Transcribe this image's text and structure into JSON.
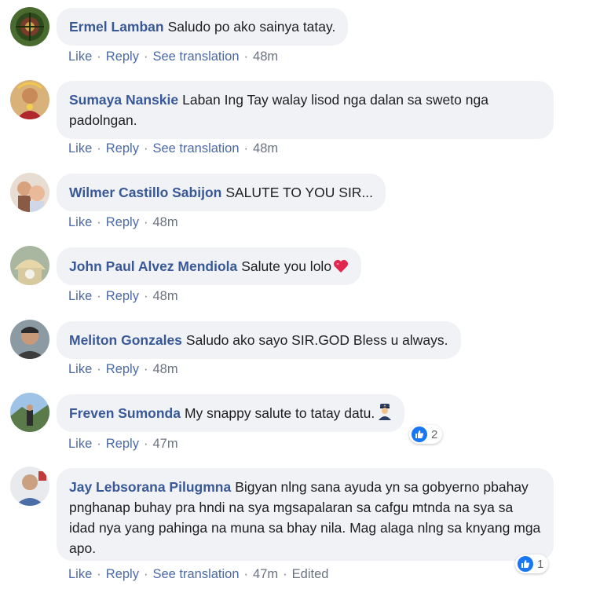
{
  "comments": [
    {
      "author": "Ermel Lamban",
      "text": "Saludo po ako sainya tatay.",
      "actions": [
        "Like",
        "Reply",
        "See translation"
      ],
      "time": "48m"
    },
    {
      "author": "Sumaya Nanskie",
      "text": "Laban Ing Tay walay lisod nga dalan sa sweto nga padolngan.",
      "actions": [
        "Like",
        "Reply",
        "See translation"
      ],
      "time": "48m"
    },
    {
      "author": "Wilmer Castillo Sabijon",
      "text": "SALUTE TO YOU SIR...",
      "actions": [
        "Like",
        "Reply"
      ],
      "time": "48m"
    },
    {
      "author": "John Paul Alvez Mendiola",
      "text": "Salute you lolo",
      "actions": [
        "Like",
        "Reply"
      ],
      "time": "48m"
    },
    {
      "author": "Meliton Gonzales",
      "text": "Saludo ako sayo SIR.GOD Bless u always.",
      "actions": [
        "Like",
        "Reply"
      ],
      "time": "48m"
    },
    {
      "author": "Freven Sumonda",
      "text": "My snappy salute to tatay datu.",
      "actions": [
        "Like",
        "Reply"
      ],
      "time": "47m",
      "reaction_count": "2"
    },
    {
      "author": "Jay Lebsorana Pilugmna",
      "text": "Bigyan nlng sana ayuda yn sa gobyerno pbahay pnghanap buhay pra hndi na sya mgsapalaran sa cafgu mtnda na sya sa idad nya yang pahinga na muna sa bhay nila. Mag alaga nlng sa knyang mga apo.",
      "actions": [
        "Like",
        "Reply",
        "See translation"
      ],
      "time": "47m",
      "edited": "Edited",
      "reaction_count": "1"
    }
  ],
  "icons": {
    "heart": "red-heart-emoji",
    "police": "police-officer-emoji",
    "like": "thumbs-up-icon"
  },
  "colors": {
    "author": "#385898",
    "bubble": "#f0f2f5",
    "like_blue": "#1877f2"
  }
}
